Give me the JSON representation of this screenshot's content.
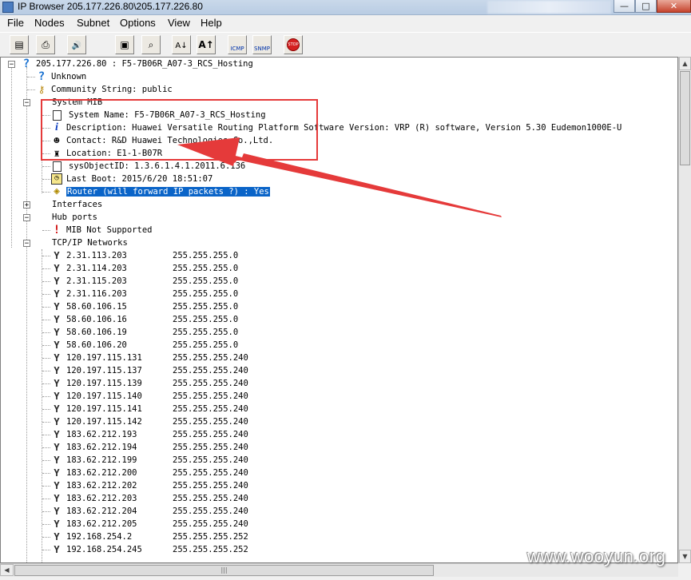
{
  "window": {
    "title": "IP Browser 205.177.226.80\\205.177.226.80",
    "controls": {
      "minimize": "—",
      "maximize": "□",
      "close": "✕"
    }
  },
  "menu": [
    "File",
    "Nodes",
    "Subnet",
    "Options",
    "View",
    "Help"
  ],
  "toolbar": {
    "buttons": [
      {
        "name": "properties-icon",
        "glyph": "▤"
      },
      {
        "name": "print-icon",
        "glyph": "⎙"
      },
      {
        "name": "speaker-icon",
        "glyph": "🔊"
      },
      {
        "name": "print-preview-icon",
        "glyph": "▣"
      },
      {
        "name": "zoom-icon",
        "glyph": "⌕"
      },
      {
        "name": "sort-az-icon",
        "glyph": "A↓"
      },
      {
        "name": "font-size-icon",
        "glyph": "A↑"
      },
      {
        "name": "icmp-icon",
        "glyph": "ICMP"
      },
      {
        "name": "snmp-icon",
        "glyph": "SNMP"
      },
      {
        "name": "stop-icon",
        "glyph": "STOP"
      }
    ]
  },
  "tree": {
    "root": {
      "label": "205.177.226.80 : F5-7B06R_A07-3_RCS_Hosting",
      "icon": "question-icon"
    },
    "root_children": [
      {
        "label": "Unknown",
        "icon": "question-icon"
      },
      {
        "label": "Community String: public",
        "icon": "key-icon"
      }
    ],
    "system_mib": {
      "label": "System MIB",
      "items": [
        {
          "label": "System Name: F5-7B06R_A07-3_RCS_Hosting",
          "icon": "document-icon"
        },
        {
          "label": "Description: Huawei Versatile Routing Platform Software Version: VRP (R) software, Version 5.30 Eudemon1000E-U",
          "icon": "info-icon"
        },
        {
          "label": "Contact: R&D Huawei Technologies Co.,Ltd.",
          "icon": "contact-icon"
        },
        {
          "label": "Location: E1-1-B07R",
          "icon": "location-icon"
        },
        {
          "label": "sysObjectID: 1.3.6.1.4.1.2011.6.136",
          "icon": "document-icon"
        },
        {
          "label": "Last Boot: 2015/6/20 18:51:07",
          "icon": "clock-icon"
        },
        {
          "label": "Router (will forward IP packets ?) : Yes",
          "icon": "router-icon"
        }
      ]
    },
    "interfaces": {
      "label": "Interfaces"
    },
    "hub_ports": {
      "label": "Hub ports",
      "items": [
        {
          "label": "MIB Not Supported",
          "icon": "alert-icon"
        }
      ]
    },
    "tcpip": {
      "label": "TCP/IP Networks",
      "items": [
        {
          "ip": "2.31.113.203",
          "mask": "255.255.255.0"
        },
        {
          "ip": "2.31.114.203",
          "mask": "255.255.255.0"
        },
        {
          "ip": "2.31.115.203",
          "mask": "255.255.255.0"
        },
        {
          "ip": "2.31.116.203",
          "mask": "255.255.255.0"
        },
        {
          "ip": "58.60.106.15",
          "mask": "255.255.255.0"
        },
        {
          "ip": "58.60.106.16",
          "mask": "255.255.255.0"
        },
        {
          "ip": "58.60.106.19",
          "mask": "255.255.255.0"
        },
        {
          "ip": "58.60.106.20",
          "mask": "255.255.255.0"
        },
        {
          "ip": "120.197.115.131",
          "mask": "255.255.255.240"
        },
        {
          "ip": "120.197.115.137",
          "mask": "255.255.255.240"
        },
        {
          "ip": "120.197.115.139",
          "mask": "255.255.255.240"
        },
        {
          "ip": "120.197.115.140",
          "mask": "255.255.255.240"
        },
        {
          "ip": "120.197.115.141",
          "mask": "255.255.255.240"
        },
        {
          "ip": "120.197.115.142",
          "mask": "255.255.255.240"
        },
        {
          "ip": "183.62.212.193",
          "mask": "255.255.255.240"
        },
        {
          "ip": "183.62.212.194",
          "mask": "255.255.255.240"
        },
        {
          "ip": "183.62.212.199",
          "mask": "255.255.255.240"
        },
        {
          "ip": "183.62.212.200",
          "mask": "255.255.255.240"
        },
        {
          "ip": "183.62.212.202",
          "mask": "255.255.255.240"
        },
        {
          "ip": "183.62.212.203",
          "mask": "255.255.255.240"
        },
        {
          "ip": "183.62.212.204",
          "mask": "255.255.255.240"
        },
        {
          "ip": "183.62.212.205",
          "mask": "255.255.255.240"
        },
        {
          "ip": "192.168.254.2",
          "mask": "255.255.255.252"
        },
        {
          "ip": "192.168.254.245",
          "mask": "255.255.255.252"
        }
      ]
    }
  },
  "annotation": {
    "color": "#e53a3a"
  },
  "watermark": "www.wooyun.org"
}
